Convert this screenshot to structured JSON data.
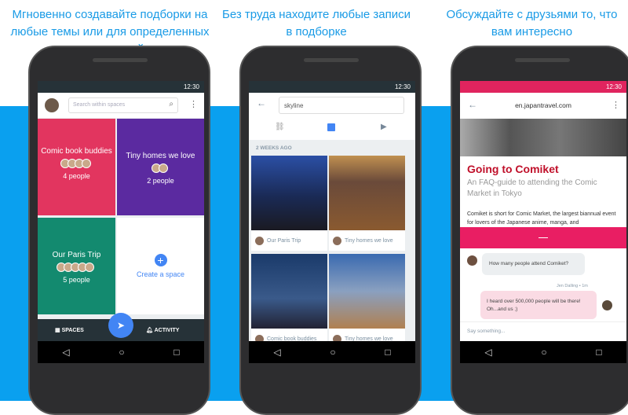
{
  "captions": [
    "Мгновенно создавайте подборки на любые темы или для определенных групп людей",
    "Без труда находите любые записи в подборке",
    "Обсуждайте с друзьями то, что вам интересно"
  ],
  "colors": {
    "band": "#0aa0ef",
    "caption": "#1a9be6",
    "accent": "#4285f4",
    "pink": "#e91e63"
  },
  "status_time": "12:30",
  "phone1": {
    "search_placeholder": "Search within spaces",
    "spaces": [
      {
        "title": "Comic book buddies",
        "people": "4 people",
        "color": "#e2355f"
      },
      {
        "title": "Tiny homes we love",
        "people": "2 people",
        "color": "#5b2aa0"
      },
      {
        "title": "Our Paris Trip",
        "people": "5 people",
        "color": "#138a6f"
      }
    ],
    "create": "Create a space",
    "tab_spaces": "SPACES",
    "tab_activity": "ACTIVITY"
  },
  "phone2": {
    "query": "skyline",
    "section": "2 WEEKS AGO",
    "results": [
      "Our Paris Trip",
      "Tiny homes we love",
      "Comic book buddies",
      "Tiny homes we love"
    ]
  },
  "phone3": {
    "domain": "en.japantravel.com",
    "title": "Going to Comiket",
    "subtitle": "An FAQ-guide to attending the Comic Market in Tokyo",
    "body": "Comiket is short for Comic Market, the largest biannual event for lovers of the Japanese anime, manga, and",
    "msg1": "How many people attend Comiket?",
    "sender": "Jen Dalling • 1m",
    "msg2": "I heard over 500,000 people will be there! Oh...and us ;)",
    "input_placeholder": "Say something..."
  }
}
